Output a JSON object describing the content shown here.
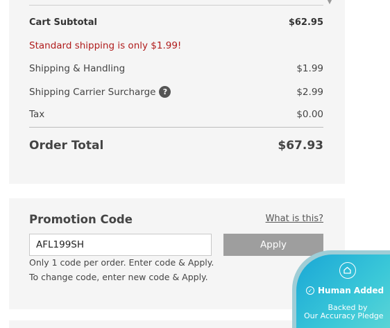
{
  "summary": {
    "cart_subtotal_label": "Cart Subtotal",
    "cart_subtotal_value": "$62.95",
    "shipping_promo_message": "Standard shipping is only $1.99!",
    "shipping_label": "Shipping & Handling",
    "shipping_value": "$1.99",
    "surcharge_label": "Shipping Carrier Surcharge",
    "surcharge_help_glyph": "?",
    "surcharge_value": "$2.99",
    "tax_label": "Tax",
    "tax_value": "$0.00",
    "order_total_label": "Order Total",
    "order_total_value": "$67.93"
  },
  "promotion": {
    "title": "Promotion Code",
    "what_link": "What is this?",
    "input_value": "AFL199SH",
    "apply_label": "Apply",
    "hint_line_1": "Only 1 code per order. Enter code & Apply.",
    "hint_line_2": "To change code, enter new code & Apply."
  },
  "badge": {
    "title": "Human Added",
    "subtitle_line_1": "Backed by",
    "subtitle_line_2": "Our Accuracy Pledge",
    "icon": "house-logo-icon"
  },
  "colors": {
    "panel_bg": "#f5f5f5",
    "promo_message": "#b01c1c",
    "apply_button": "#9e9e9e",
    "badge_gradient_start": "#1aa7d6",
    "badge_gradient_end": "#5fd6d6"
  }
}
